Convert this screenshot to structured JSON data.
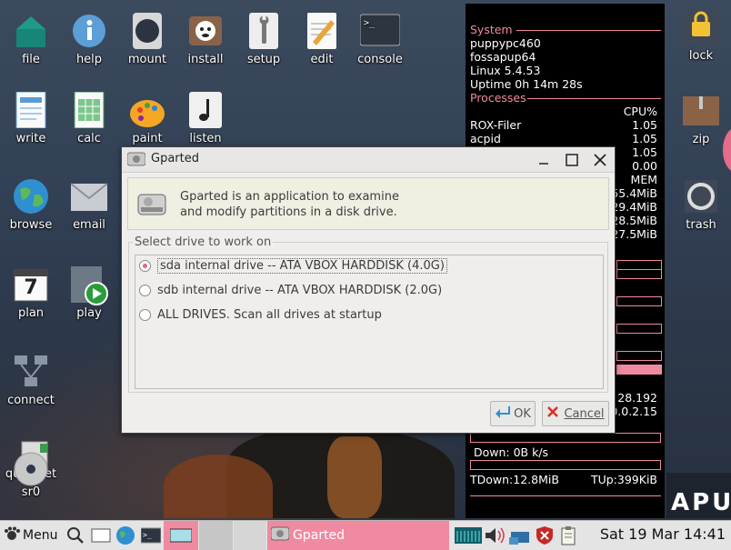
{
  "desktop": {
    "icons_left": [
      {
        "name": "file",
        "label": "file"
      },
      {
        "name": "help",
        "label": "help"
      },
      {
        "name": "mount",
        "label": "mount"
      },
      {
        "name": "install",
        "label": "install"
      },
      {
        "name": "setup",
        "label": "setup"
      },
      {
        "name": "edit",
        "label": "edit"
      },
      {
        "name": "console",
        "label": "console"
      },
      {
        "name": "write",
        "label": "write"
      },
      {
        "name": "calc",
        "label": "calc"
      },
      {
        "name": "paint",
        "label": "paint"
      },
      {
        "name": "listen",
        "label": "listen"
      },
      {
        "name": "browse",
        "label": "browse"
      },
      {
        "name": "email",
        "label": "email"
      },
      {
        "name": "plan",
        "label": "plan"
      },
      {
        "name": "play",
        "label": "play"
      },
      {
        "name": "connect",
        "label": "connect"
      },
      {
        "name": "quickpet",
        "label": "quickpet"
      },
      {
        "name": "sr0",
        "label": "sr0"
      }
    ],
    "icons_right": [
      {
        "name": "lock",
        "label": "lock"
      },
      {
        "name": "zip",
        "label": "zip"
      },
      {
        "name": "trash",
        "label": "trash"
      }
    ],
    "plan_day": "7",
    "wallpaper_text": "APU"
  },
  "conky": {
    "system_head": "System",
    "hostname": "puppypc460",
    "distro": "fossapup64",
    "kernel": "Linux 5.4.53",
    "uptime": "Uptime 0h 14m 28s",
    "processes_head": "Processes",
    "cpu_header": "CPU%",
    "cpu_procs": [
      {
        "name": "ROX-Filer",
        "value": "1.05"
      },
      {
        "name": "acpid",
        "value": "1.05"
      },
      {
        "name": "",
        "value": "1.05"
      },
      {
        "name": "",
        "value": "0.00"
      }
    ],
    "mem_header": "MEM",
    "mem_values": [
      "55.4MiB",
      "29.4MiB",
      "28.5MiB",
      "27.5MiB"
    ],
    "ip_partial_1": "28.192",
    "ip_partial_2": "0.0.2.15",
    "down": "Down: 0B  k/s",
    "tdown": "TDown:12.8MiB",
    "tup": "TUp:399KiB"
  },
  "dialog": {
    "title": "Gparted",
    "info": "Gparted is an application to examine\nand modify partitions in a disk drive.",
    "group_label": "Select drive to work on",
    "options": [
      {
        "label": "sda internal drive -- ATA VBOX HARDDISK (4.0G)",
        "selected": true
      },
      {
        "label": "sdb internal drive -- ATA VBOX HARDDISK (2.0G)",
        "selected": false
      },
      {
        "label": "ALL DRIVES. Scan all drives at startup",
        "selected": false
      }
    ],
    "ok_label": "OK",
    "cancel_label": "Cancel"
  },
  "taskbar": {
    "menu_label": "Menu",
    "task_label": "Gparted",
    "clock": "Sat 19 Mar 14:41"
  },
  "colors": {
    "accent_pink": "#f08aa0",
    "radio_selected": "#e2667f",
    "conky_bg": "#000000"
  }
}
